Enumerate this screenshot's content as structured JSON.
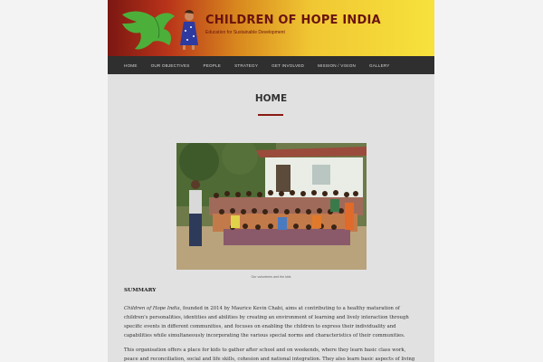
{
  "site": {
    "title": "CHILDREN OF HOPE INDIA",
    "tagline": "Education for Sustainable Development"
  },
  "nav": {
    "items": [
      "HOME",
      "OUR OBJECTIVES",
      "PEOPLE",
      "STRATEGY",
      "GET INVOLVED",
      "MISSION / VISION",
      "GALLERY"
    ]
  },
  "main": {
    "heading": "HOME",
    "caption": "Our volunteers and the kids",
    "summary_label": "SUMMARY",
    "p1_em": "Children of Hope India",
    "p1_rest": ", founded in 2014 by Maurice Kevin Chabi, aims at contributing to a healthy maturation of children's personalities, identities and abilities by creating an environment of learning and lively interaction through specific events in different communities, and focuses on enabling the children to express their individuality and capabilities while simultaneously incorporating the various special norms and characteristics of their communities.",
    "p2": "This organisation offers a place for kids to gather after school and on weekends, where they learn basic class work, peace and reconciliation, social and life skills, cohesion and national integration. They also learn basic aspects of living in the"
  },
  "colors": {
    "nav_bg": "#2f2f2f",
    "title": "#6a1310",
    "accent": "#8a1a14",
    "page_bg": "#e1e1e1"
  }
}
